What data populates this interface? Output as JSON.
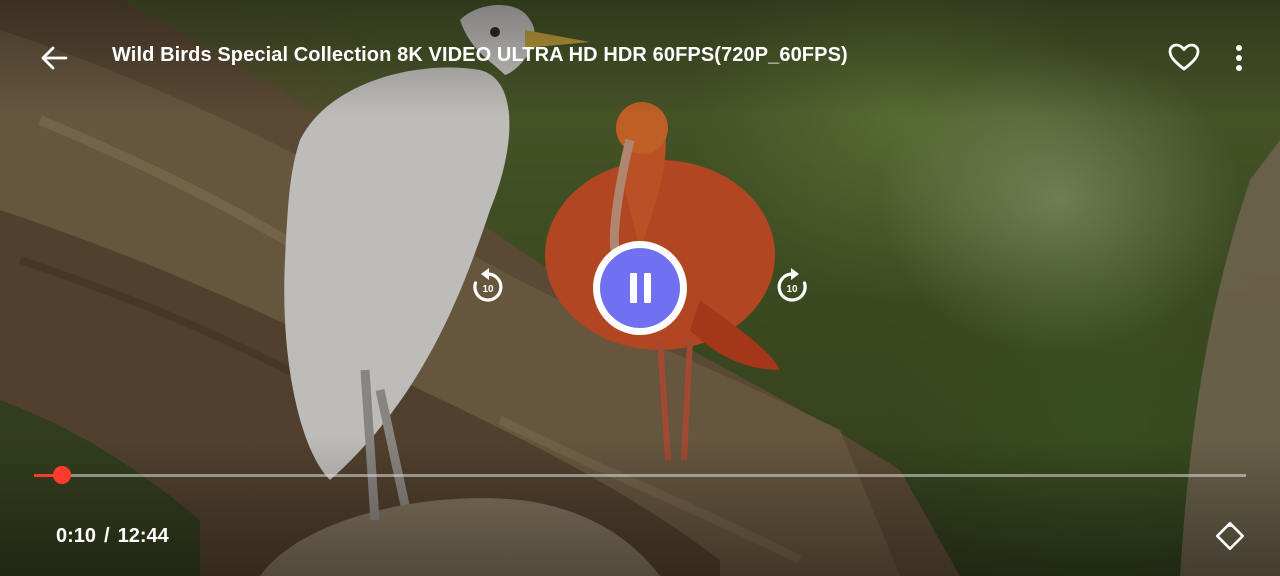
{
  "player": {
    "title": "Wild Birds Special Collection 8K VIDEO ULTRA HD HDR 60FPS(720P_60FPS)",
    "current_time": "0:10",
    "separator": "/",
    "duration": "12:44",
    "progress_fraction": 0.0134,
    "skip_back_seconds": "10",
    "skip_forward_seconds": "10",
    "state": "playing"
  },
  "icons": {
    "back": "arrow-back-icon",
    "favorite": "heart-outline-icon",
    "more": "more-vert-icon",
    "rewind": "replay-10-icon",
    "forward": "forward-10-icon",
    "pause": "pause-icon",
    "rotate": "screen-rotation-icon"
  },
  "colors": {
    "accent": "#6f70f2",
    "progress": "#ff3b30"
  }
}
